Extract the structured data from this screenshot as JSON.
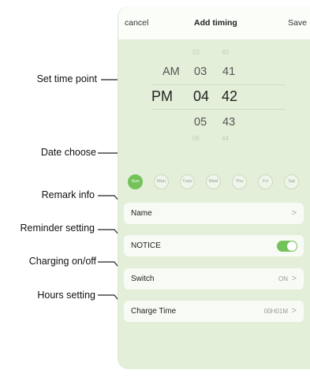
{
  "annotations": {
    "set_time_point": "Set time point",
    "date_choose": "Date choose",
    "remark_info": "Remark info",
    "reminder_setting": "Reminder setting",
    "charging_onoff": "Charging on/off",
    "hours_setting": "Hours setting"
  },
  "header": {
    "cancel": "cancel",
    "title": "Add timing",
    "save": "Save"
  },
  "picker": {
    "ampm": [
      "AM",
      "PM"
    ],
    "hours": [
      "02",
      "03",
      "04",
      "05",
      "06"
    ],
    "minutes": [
      "40",
      "41",
      "42",
      "43",
      "44"
    ],
    "selected": {
      "period": "PM",
      "hour": "04",
      "minute": "42"
    }
  },
  "days": {
    "labels": [
      "Sun",
      "Mon",
      "Tues",
      "Wed",
      "Thu",
      "Fri",
      "Sat"
    ],
    "selected": "Sun"
  },
  "rows": {
    "name": {
      "label": "Name",
      "chevron": ">"
    },
    "notice": {
      "label": "NOTICE",
      "enabled": true
    },
    "switch": {
      "label": "Switch",
      "value": "ON",
      "chevron": ">"
    },
    "charge_time": {
      "label": "Charge Time",
      "value": "00H01M",
      "chevron": ">"
    }
  },
  "colors": {
    "accent": "#73c25a",
    "panel": "#e3efd9",
    "row": "#f8fbf5"
  }
}
